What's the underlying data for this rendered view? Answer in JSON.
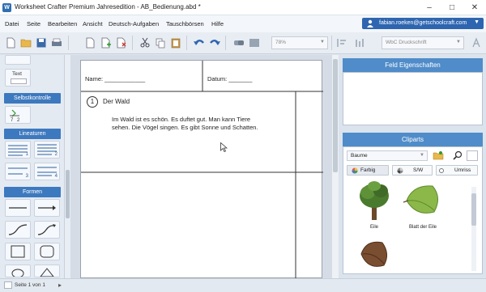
{
  "window": {
    "title": "Worksheet Crafter Premium Jahresedition - AB_Bedienung.abd *"
  },
  "menu": [
    "Datei",
    "Seite",
    "Bearbeiten",
    "Ansicht",
    "Deutsch-Aufgaben",
    "Tauschbörsen",
    "Hilfe"
  ],
  "account": {
    "email": "fabian.roeken@getschoolcraft.com"
  },
  "toolbar": {
    "zoom": "78%",
    "font": "WbC Druckschrift"
  },
  "left_panel": {
    "text_tile": "Text",
    "selbstkontrolle": "Selbstkontrolle",
    "lineaturen": "Lineaturen",
    "formen": "Formen",
    "tile_numbers": [
      "1",
      "2",
      "3",
      "4"
    ]
  },
  "document": {
    "name_label": "Name: ____________",
    "datum_label": "Datum: _______",
    "task_number": "1",
    "task_title": "Der Wald",
    "paragraph_lines": [
      "Im Wald ist es schön. Es duftet gut. Man kann Tiere",
      "sehen. Die Vögel singen. Es gibt Sonne und Schatten."
    ]
  },
  "right_panel": {
    "feld_title": "Feld Eigenschaften",
    "cliparts_title": "Cliparts",
    "category": "Baume",
    "radio_options": [
      "Farbig",
      "S/W",
      "Umriss"
    ],
    "selected_radio": "Farbig",
    "cliparts": [
      {
        "caption": "Eile",
        "icon": "tree-icon"
      },
      {
        "caption": "Blatt der Eile",
        "icon": "leaf-icon"
      },
      {
        "caption": "",
        "icon": "leaf-icon"
      }
    ]
  },
  "status": {
    "page": "Seite 1 von 1"
  },
  "colors": {
    "accent": "#2e65b0",
    "header": "#4f8cc9",
    "section": "#3d79bf"
  }
}
